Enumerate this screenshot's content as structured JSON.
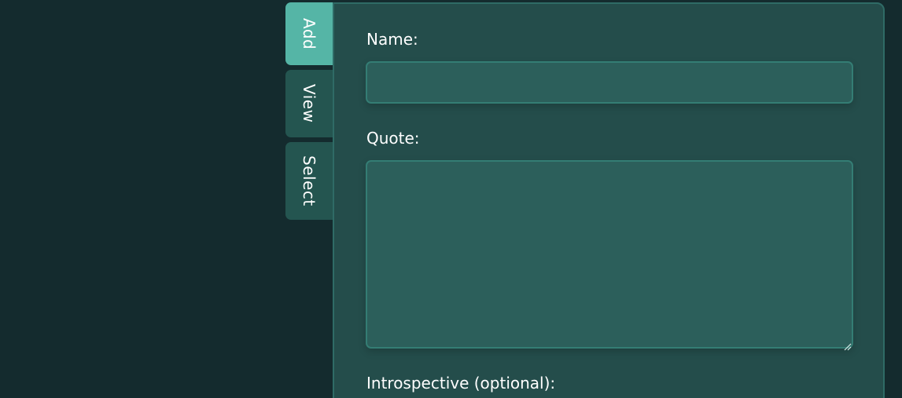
{
  "tabs": [
    {
      "label": "Add",
      "active": true
    },
    {
      "label": "View",
      "active": false
    },
    {
      "label": "Select",
      "active": false
    }
  ],
  "form": {
    "name_label": "Name:",
    "name_value": "",
    "quote_label": "Quote:",
    "quote_value": "",
    "introspective_label": "Introspective (optional):"
  },
  "colors": {
    "background": "#142b2e",
    "panel": "#244d4b",
    "tab_active": "#55b5a6",
    "tab_inactive": "#245550",
    "input_fill": "#2c5f5b",
    "input_border": "#347d74"
  }
}
